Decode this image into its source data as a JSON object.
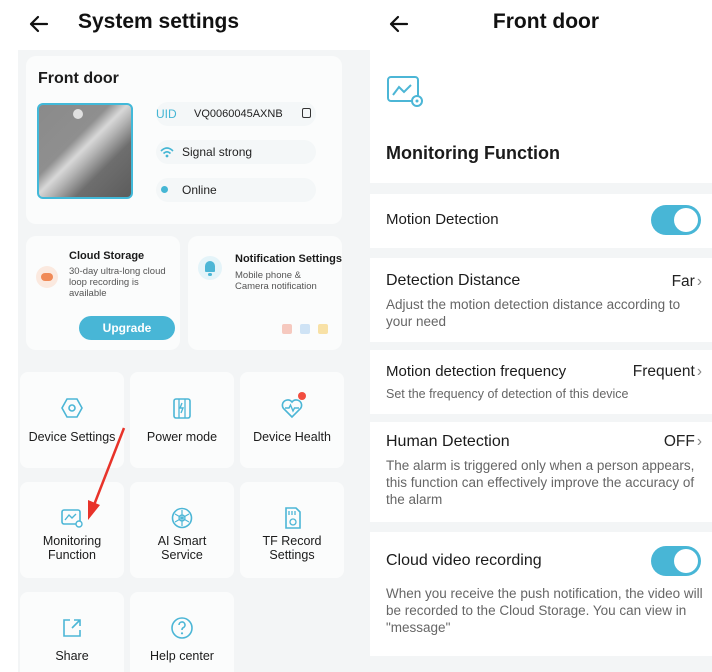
{
  "left": {
    "title": "System settings",
    "device": {
      "name": "Front door",
      "uid_label": "UID",
      "uid_value": "VQ0060045AXNB",
      "signal": "Signal strong",
      "status": "Online"
    },
    "cloud": {
      "title": "Cloud Storage",
      "desc": "30-day ultra-long cloud loop recording is available",
      "button": "Upgrade"
    },
    "notification": {
      "title": "Notification Settings",
      "desc": "Mobile phone & Camera notification"
    },
    "tiles": {
      "device_settings": "Device Settings",
      "power_mode": "Power mode",
      "device_health": "Device Health",
      "monitoring_line1": "Monitoring",
      "monitoring_line2": "Function",
      "ai_line1": "AI Smart",
      "ai_line2": "Service",
      "tf_line1": "TF Record",
      "tf_line2": "Settings",
      "share": "Share",
      "help": "Help center"
    }
  },
  "right": {
    "title": "Front door",
    "section_title": "Monitoring Function",
    "motion_detection": {
      "label": "Motion Detection",
      "enabled": true
    },
    "detection_distance": {
      "label": "Detection Distance",
      "value": "Far",
      "desc": "Adjust the motion detection distance according to your need"
    },
    "detection_frequency": {
      "label": "Motion detection frequency",
      "value": "Frequent",
      "desc": "Set the frequency of detection of this device"
    },
    "human_detection": {
      "label": "Human Detection",
      "value": "OFF",
      "desc": "The alarm is triggered only when a person appears, this function can effectively improve the accuracy of the alarm"
    },
    "cloud_recording": {
      "label": "Cloud video recording",
      "enabled": true,
      "desc": "When you receive the push notification, the video will be recorded to the Cloud Storage. You can view in \"message\""
    }
  },
  "colors": {
    "accent": "#48b6d6",
    "alert": "#f24d3f",
    "annotation_arrow": "#e8332a"
  }
}
